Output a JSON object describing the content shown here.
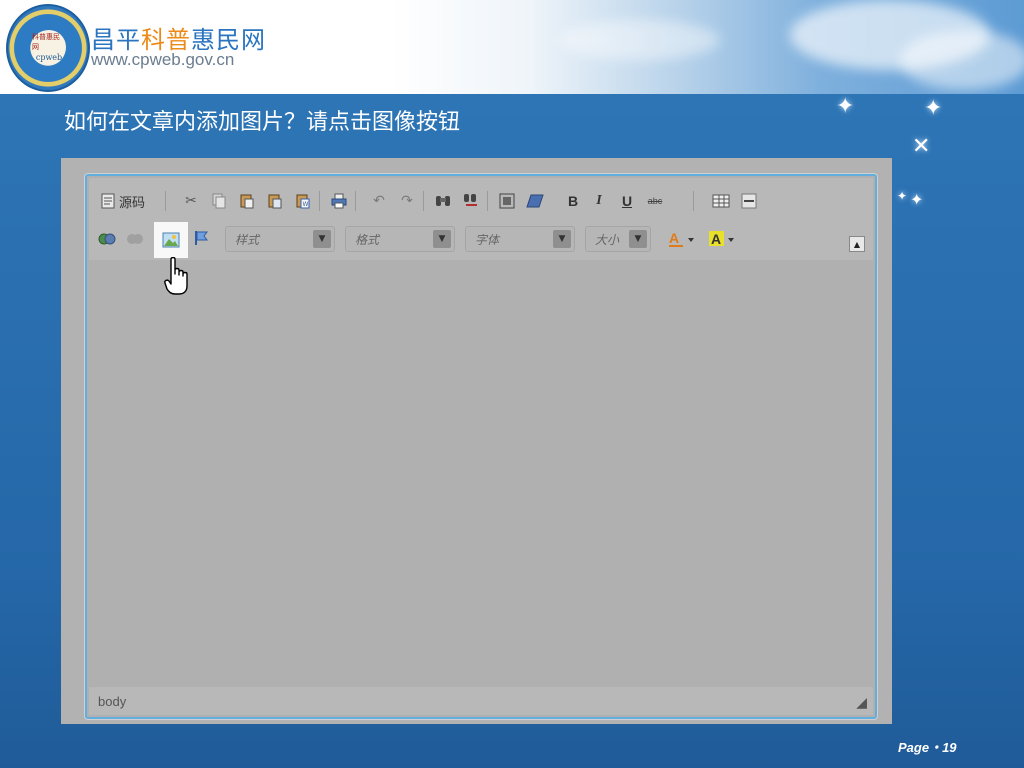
{
  "header": {
    "site_name_a": "昌平",
    "site_name_b": "科普",
    "site_name_c": "惠民网",
    "site_url": "www.cpweb.gov.cn",
    "logo_text": "科普惠民网",
    "logo_sub": "cpweb"
  },
  "slide": {
    "title": "如何在文章内添加图片？请点击图像按钮"
  },
  "editor": {
    "toolbar_row1": {
      "source_label": "源码",
      "icons": [
        "source-icon",
        "cut-icon",
        "copy-icon",
        "paste-icon",
        "paste-text-icon",
        "paste-word-icon",
        "print-icon",
        "undo-icon",
        "redo-icon",
        "find-icon",
        "replace-icon",
        "select-all-icon",
        "remove-format-icon",
        "bold-icon",
        "italic-icon",
        "underline-icon",
        "strike-icon",
        "table-icon",
        "horizontal-rule-icon"
      ]
    },
    "toolbar_row2": {
      "combo_style": "样式",
      "combo_format": "格式",
      "combo_font": "字体",
      "combo_size": "大小",
      "icons": [
        "link-icon",
        "unlink-icon",
        "image-icon",
        "anchor-icon",
        "text-color-icon",
        "background-color-icon"
      ]
    },
    "bold_glyph": "B",
    "italic_glyph": "I",
    "underline_glyph": "U",
    "strike_glyph": "abc",
    "status_path": "body"
  },
  "footer": {
    "page_label": "Page・19"
  },
  "colors": {
    "editor_border": "#62aede",
    "title_text": "#ffffff",
    "brand_blue": "#2a74c0",
    "brand_orange": "#ec8a19"
  }
}
